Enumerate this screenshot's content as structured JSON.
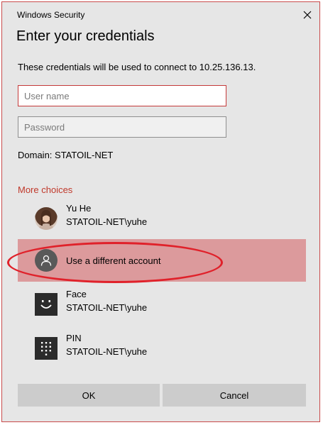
{
  "window": {
    "title": "Windows Security"
  },
  "heading": "Enter your credentials",
  "description": "These credentials will be used to connect to 10.25.136.13.",
  "fields": {
    "username_placeholder": "User name",
    "username_value": "",
    "password_placeholder": "Password",
    "password_value": ""
  },
  "domain": "Domain: STATOIL-NET",
  "more_choices": "More choices",
  "choices": [
    {
      "name": "Yu He",
      "account": "STATOIL-NET\\yuhe",
      "icon": "user-photo"
    },
    {
      "label": "Use a different account",
      "icon": "person-icon",
      "selected": true
    },
    {
      "name": "Face",
      "account": "STATOIL-NET\\yuhe",
      "icon": "face-icon"
    },
    {
      "name": "PIN",
      "account": "STATOIL-NET\\yuhe",
      "icon": "pin-keypad-icon"
    }
  ],
  "buttons": {
    "ok": "OK",
    "cancel": "Cancel"
  },
  "colors": {
    "dialog_background": "#e6e6e6",
    "accent_red": "#c0392b",
    "selected_row": "#dc9a9c",
    "annotation_red": "#e0212a",
    "button_gray": "#cccccc"
  }
}
